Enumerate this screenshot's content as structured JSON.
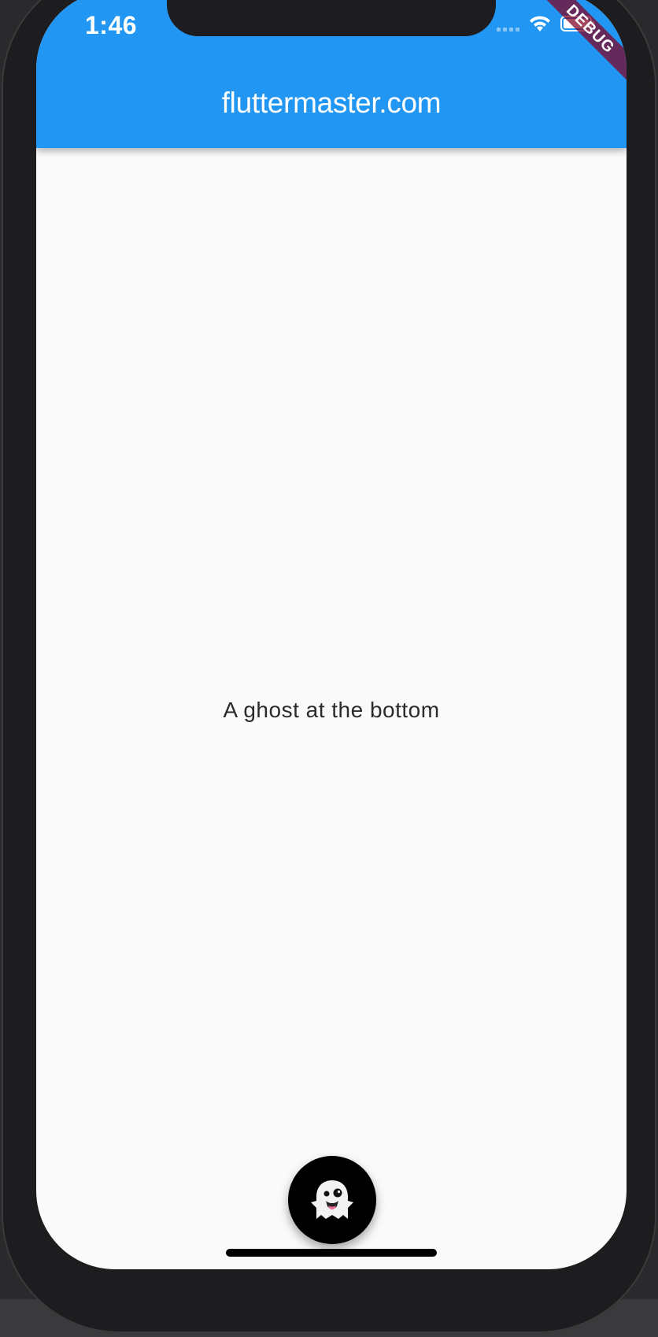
{
  "status_bar": {
    "time": "1:46",
    "icons": [
      "signal-icon",
      "wifi-icon",
      "battery-icon"
    ]
  },
  "app_bar": {
    "title": "fluttermaster.com",
    "color": "#2196f3"
  },
  "debug_banner": {
    "label": "DEBUG",
    "color": "#800020"
  },
  "body": {
    "text": "A ghost at the bottom",
    "background": "#fafafa"
  },
  "fab": {
    "icon": "ghost-icon",
    "color": "#000000"
  }
}
